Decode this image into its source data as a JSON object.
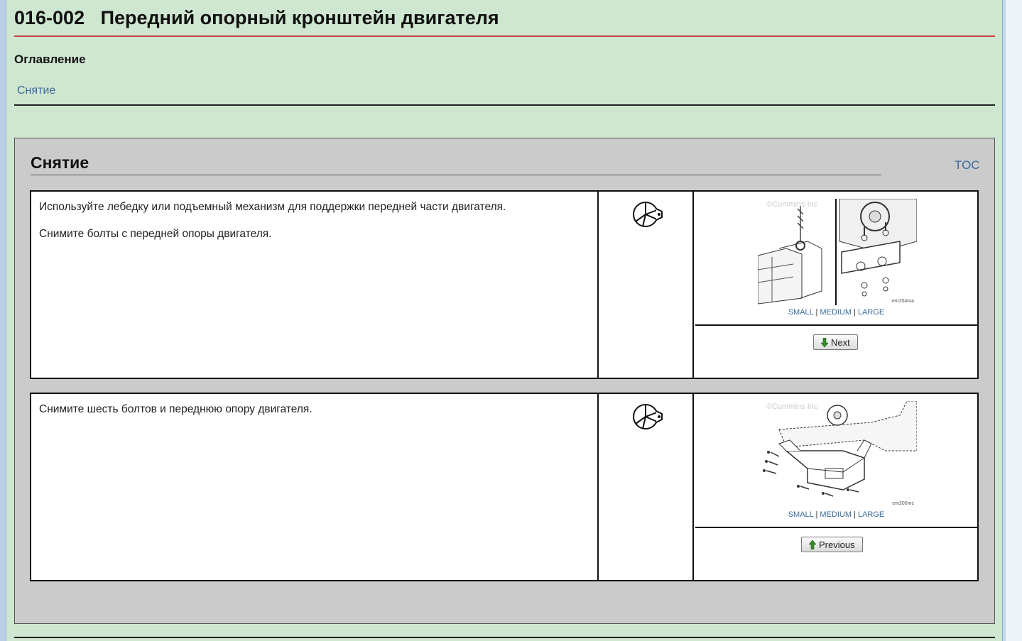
{
  "document": {
    "code": "016-002",
    "title": "Передний опорный кронштейн двигателя"
  },
  "toc": {
    "heading": "Оглавление",
    "links": [
      "Снятие"
    ]
  },
  "section": {
    "title": "Снятие",
    "toc_link": "TOC",
    "steps": [
      {
        "paragraphs": [
          "Используйте лебедку или подъемный механизм для поддержки передней части двигателя.",
          "Снимите болты с передней опоры двигателя."
        ],
        "tool_icon": "wrench-tool-icon",
        "figure": {
          "watermark": "©Cummins Inc",
          "code": "em204ma"
        },
        "sizes": [
          "SMALL",
          "MEDIUM",
          "LARGE"
        ],
        "button": {
          "label": "Next",
          "icon": "arrow-down-icon"
        }
      },
      {
        "paragraphs": [
          "Снимите шесть болтов и переднюю опору двигателя."
        ],
        "tool_icon": "wrench-tool-icon",
        "figure": {
          "watermark": "©Cummins Inc",
          "code": "em200mc"
        },
        "sizes": [
          "SMALL",
          "MEDIUM",
          "LARGE"
        ],
        "button": {
          "label": "Previous",
          "icon": "arrow-up-icon"
        }
      }
    ]
  },
  "colors": {
    "page_background": "#cfe6d1",
    "section_background": "#cbcbcb",
    "title_rule": "#c94040",
    "link": "#3a6c9a",
    "arrow": "#3a8a2a"
  }
}
